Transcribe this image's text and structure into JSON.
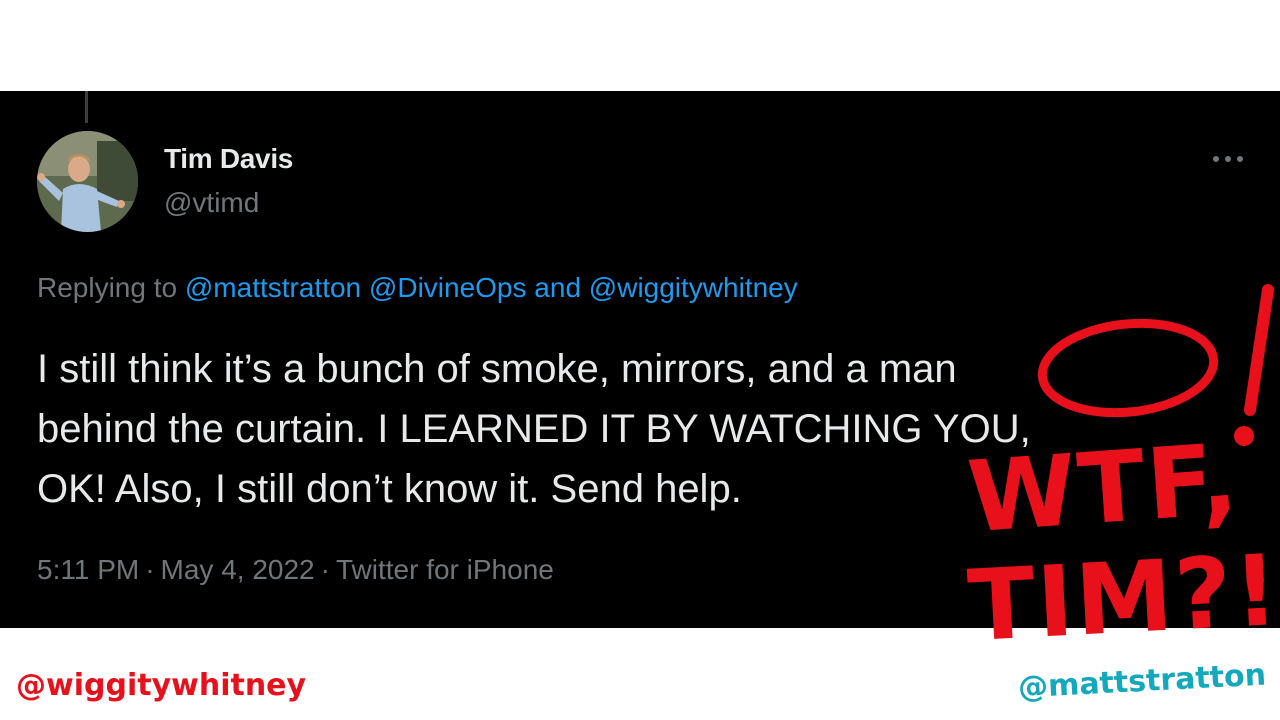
{
  "tweet": {
    "author_name": "Tim Davis",
    "author_handle": "@vtimd",
    "replying_to_prefix": "Replying to",
    "mentions": [
      "@mattstratton",
      "@DivineOps",
      "@wiggitywhitney"
    ],
    "mention_joiner": "and",
    "text_lines": [
      "I still think it’s a bunch of smoke, mirrors, and a man",
      "behind the curtain. I LEARNED IT BY WATCHING YOU,",
      "OK! Also, I still don’t know it. Send help."
    ],
    "time": "5:11 PM",
    "date": "May 4, 2022",
    "source": "Twitter for iPhone",
    "separator": "·",
    "icons": [
      "more-options-icon",
      "avatar-photo"
    ]
  },
  "annotations": {
    "exclamation": "!",
    "line1": "WTF,",
    "line2": "TIM?!",
    "color": "#e8101a"
  },
  "footer": {
    "left_handle": "@wiggitywhitney",
    "right_handle": "@mattstratton",
    "left_color": "#e8101a",
    "right_color": "#14a8bc"
  }
}
